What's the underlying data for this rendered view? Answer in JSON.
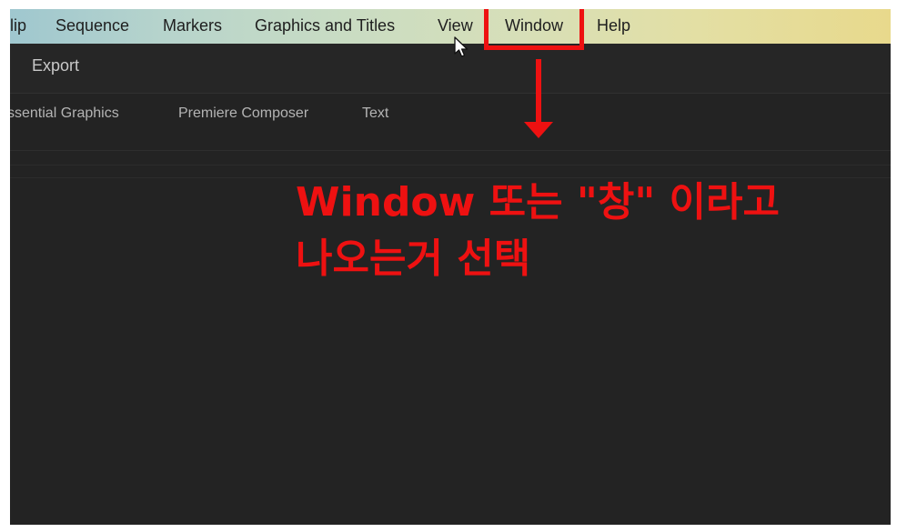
{
  "menubar": {
    "items": [
      {
        "label": "lip"
      },
      {
        "label": "Sequence"
      },
      {
        "label": "Markers"
      },
      {
        "label": "Graphics and Titles"
      },
      {
        "label": "View"
      },
      {
        "label": "Window"
      },
      {
        "label": "Help"
      }
    ]
  },
  "toolbar": {
    "export_label": "Export"
  },
  "workspaces": {
    "tabs": [
      {
        "label": "ssential Graphics"
      },
      {
        "label": "Premiere Composer"
      },
      {
        "label": "Text"
      }
    ]
  },
  "annotation": {
    "line1": "Window 또는 \"창\" 이라고",
    "line2": "나오는거 선택",
    "color": "#ee1111",
    "icon_arrow": "arrow-down-icon",
    "icon_cursor": "mouse-pointer-icon"
  }
}
